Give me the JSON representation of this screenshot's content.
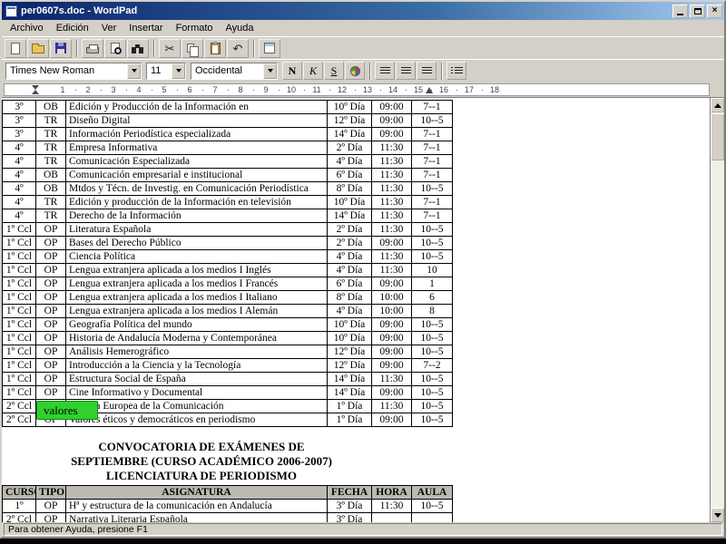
{
  "window": {
    "title": "per0607s.doc - WordPad",
    "close_glyph": "×"
  },
  "menu": {
    "items": [
      "Archivo",
      "Edición",
      "Ver",
      "Insertar",
      "Formato",
      "Ayuda"
    ]
  },
  "toolbar": {
    "cut_glyph": "✂",
    "undo_glyph": "↶",
    "icons": [
      "new-document-icon",
      "open-folder-icon",
      "save-icon",
      "print-icon",
      "print-preview-icon",
      "find-icon",
      "cut-icon",
      "copy-icon",
      "paste-icon",
      "undo-icon",
      "date-time-icon"
    ]
  },
  "formatbar": {
    "font": "Times New Roman",
    "size": "11",
    "script": "Occidental",
    "bold": "N",
    "italic": "K",
    "underline": "S"
  },
  "ruler": {
    "numbers": [
      "1",
      "2",
      "3",
      "4",
      "5",
      "6",
      "7",
      "8",
      "9",
      "10",
      "11",
      "12",
      "13",
      "14",
      "15",
      "16",
      "17",
      "18"
    ]
  },
  "doc": {
    "table1": {
      "rows": [
        {
          "curso": "3º",
          "tipo": "OB",
          "asignatura": "Edición y Producción de la Información en",
          "fecha": "10º Día",
          "hora": "09:00",
          "aula": "7--1"
        },
        {
          "curso": "3º",
          "tipo": "TR",
          "asignatura": "Diseño Digital",
          "fecha": "12º Día",
          "hora": "09:00",
          "aula": "10--5"
        },
        {
          "curso": "3º",
          "tipo": "TR",
          "asignatura": "Información Periodística especializada",
          "fecha": "14º Día",
          "hora": "09:00",
          "aula": "7--1"
        },
        {
          "curso": "4º",
          "tipo": "TR",
          "asignatura": "Empresa Informativa",
          "fecha": "2º Día",
          "hora": "11:30",
          "aula": "7--1"
        },
        {
          "curso": "4º",
          "tipo": "TR",
          "asignatura": "Comunicación Especializada",
          "fecha": "4º Día",
          "hora": "11:30",
          "aula": "7--1"
        },
        {
          "curso": "4º",
          "tipo": "OB",
          "asignatura": "Comunicación empresarial e institucional",
          "fecha": "6º Día",
          "hora": "11:30",
          "aula": "7--1"
        },
        {
          "curso": "4º",
          "tipo": "OB",
          "asignatura": "Mtdos y Técn. de Investig. en Comunicación Periodística",
          "fecha": "8º Día",
          "hora": "11:30",
          "aula": "10--5"
        },
        {
          "curso": "4º",
          "tipo": "TR",
          "asignatura": "Edición y producción de la Información en televisión",
          "fecha": "10º Día",
          "hora": "11:30",
          "aula": "7--1"
        },
        {
          "curso": "4º",
          "tipo": "TR",
          "asignatura": "Derecho de la Información",
          "fecha": "14º Día",
          "hora": "11:30",
          "aula": "7--1"
        },
        {
          "curso": "1º Ccl",
          "tipo": "OP",
          "asignatura": "Literatura Española",
          "fecha": "2º Día",
          "hora": "11:30",
          "aula": "10--5"
        },
        {
          "curso": "1º Ccl",
          "tipo": "OP",
          "asignatura": "Bases del Derecho Público",
          "fecha": "2º Día",
          "hora": "09:00",
          "aula": "10--5"
        },
        {
          "curso": "1º Ccl",
          "tipo": "OP",
          "asignatura": "Ciencia Política",
          "fecha": "4º Día",
          "hora": "11:30",
          "aula": "10--5"
        },
        {
          "curso": "1º Ccl",
          "tipo": "OP",
          "asignatura": "Lengua extranjera aplicada a los medios I Inglés",
          "fecha": "4º Día",
          "hora": "11:30",
          "aula": "10"
        },
        {
          "curso": "1º Ccl",
          "tipo": "OP",
          "asignatura": "Lengua extranjera aplicada a los medios I Francés",
          "fecha": "6º Día",
          "hora": "09:00",
          "aula": "1"
        },
        {
          "curso": "1º Ccl",
          "tipo": "OP",
          "asignatura": "Lengua extranjera aplicada a los medios I Italiano",
          "fecha": "8º Día",
          "hora": "10:00",
          "aula": "6"
        },
        {
          "curso": "1º Ccl",
          "tipo": "OP",
          "asignatura": "Lengua extranjera aplicada a los medios I Alemán",
          "fecha": "4º Día",
          "hora": "10:00",
          "aula": "8"
        },
        {
          "curso": "1º Ccl",
          "tipo": "OP",
          "asignatura": "Geografía Política del mundo",
          "fecha": "10º Día",
          "hora": "09:00",
          "aula": "10--5"
        },
        {
          "curso": "1º Ccl",
          "tipo": "OP",
          "asignatura": "Historia de Andalucía Moderna y Contemporánea",
          "fecha": "10º Día",
          "hora": "09:00",
          "aula": "10--5"
        },
        {
          "curso": "1º Ccl",
          "tipo": "OP",
          "asignatura": "Análisis Hemerográfico",
          "fecha": "12º Día",
          "hora": "09:00",
          "aula": "10--5"
        },
        {
          "curso": "1º Ccl",
          "tipo": "OP",
          "asignatura": "Introducción a la Ciencia y la Tecnología",
          "fecha": "12º Día",
          "hora": "09:00",
          "aula": "7--2"
        },
        {
          "curso": "1º Ccl",
          "tipo": "OP",
          "asignatura": "Estructura Social de España",
          "fecha": "14º Día",
          "hora": "11:30",
          "aula": "10--5"
        },
        {
          "curso": "1º Ccl",
          "tipo": "OP",
          "asignatura": "Cine Informativo y Documental",
          "fecha": "14º Día",
          "hora": "09:00",
          "aula": "10--5"
        },
        {
          "curso": "2º Ccl",
          "tipo": "OP",
          "asignatura": "Cultura Europea de la Comunicación",
          "fecha": "1º Día",
          "hora": "11:30",
          "aula": "10--5"
        },
        {
          "curso": "2º Ccl",
          "tipo": "OP",
          "asignatura": "Valores éticos y democráticos en periodismo",
          "fecha": "1º Día",
          "hora": "09:00",
          "aula": "10--5"
        }
      ]
    },
    "highlight": {
      "text": "valores",
      "color": "#2ed12e"
    },
    "heading": {
      "line1": "CONVOCATORIA DE EXÁMENES DE",
      "line2": "SEPTIEMBRE (CURSO ACADÉMICO 2006-2007)",
      "line3": "LICENCIATURA DE PERIODISMO"
    },
    "table2": {
      "headers": [
        "CURSO",
        "TIPO",
        "ASIGNATURA",
        "FECHA",
        "HORA",
        "AULA"
      ],
      "rows": [
        {
          "curso": "1º",
          "tipo": "OP",
          "asignatura": "Hª y estructura de la comunicación en Andalucía",
          "fecha": "3º Día",
          "hora": "11:30",
          "aula": "10--5"
        },
        {
          "curso": "2º Ccl",
          "tipo": "OP",
          "asignatura": "Narrativa Literaria Española",
          "fecha": "3º Día",
          "hora": "",
          "aula": ""
        }
      ]
    }
  },
  "statusbar": {
    "text": "Para obtener Ayuda, presione F1"
  }
}
